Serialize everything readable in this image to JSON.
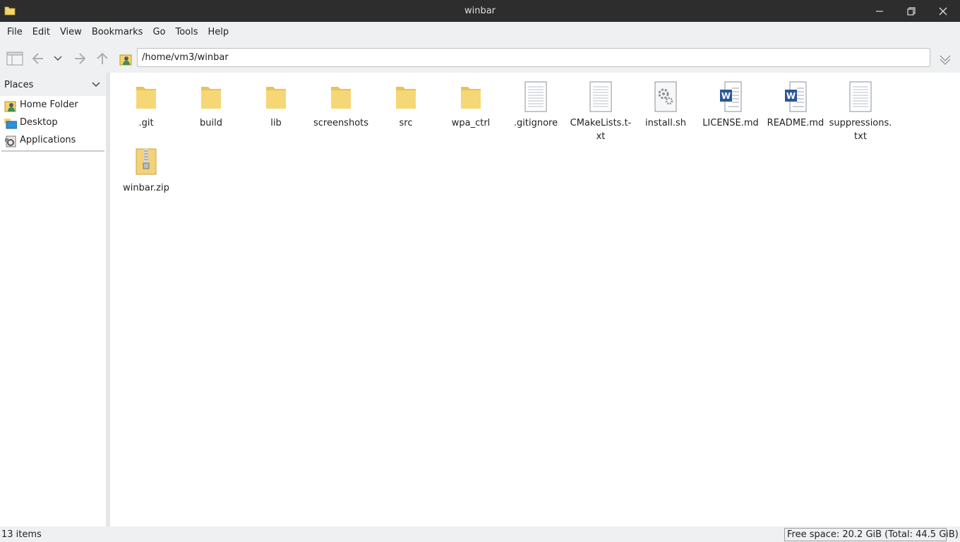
{
  "window": {
    "title": "winbar",
    "icon": "folder-icon",
    "controls": [
      "minimize-icon",
      "maximize-icon",
      "close-icon"
    ]
  },
  "menubar": {
    "items": [
      "File",
      "Edit",
      "View",
      "Bookmarks",
      "Go",
      "Tools",
      "Help"
    ]
  },
  "toolbar": {
    "buttons": [
      "new-window-icon",
      "back-icon",
      "history-dropdown-icon",
      "forward-icon",
      "up-icon",
      "home-icon",
      "go-icon"
    ],
    "address": "/home/vm3/winbar"
  },
  "sidebar": {
    "header": "Places",
    "items": [
      {
        "label": "Home Folder",
        "icon": "home-folder-icon"
      },
      {
        "label": "Desktop",
        "icon": "desktop-icon"
      },
      {
        "label": "Applications",
        "icon": "applications-icon"
      }
    ]
  },
  "files": [
    {
      "name": ".git",
      "type": "folder"
    },
    {
      "name": "build",
      "type": "folder"
    },
    {
      "name": "lib",
      "type": "folder"
    },
    {
      "name": "screenshots",
      "type": "folder"
    },
    {
      "name": "src",
      "type": "folder"
    },
    {
      "name": "wpa_ctrl",
      "type": "folder"
    },
    {
      "name": ".gitignore",
      "type": "text"
    },
    {
      "name": "CMakeLists.t-xt",
      "type": "text"
    },
    {
      "name": "install.sh",
      "type": "script"
    },
    {
      "name": "LICENSE.md",
      "type": "word"
    },
    {
      "name": "README.md",
      "type": "word"
    },
    {
      "name": "suppressions.txt",
      "type": "text"
    },
    {
      "name": "winbar.zip",
      "type": "zip"
    }
  ],
  "status": {
    "items": "13 items",
    "free_space": "Free space: 20.2 GiB (Total: 44.5 GiB)"
  },
  "colors": {
    "titlebar": "#2d2d2d",
    "folder": "#f4d46b",
    "word_blue": "#2b5797"
  }
}
